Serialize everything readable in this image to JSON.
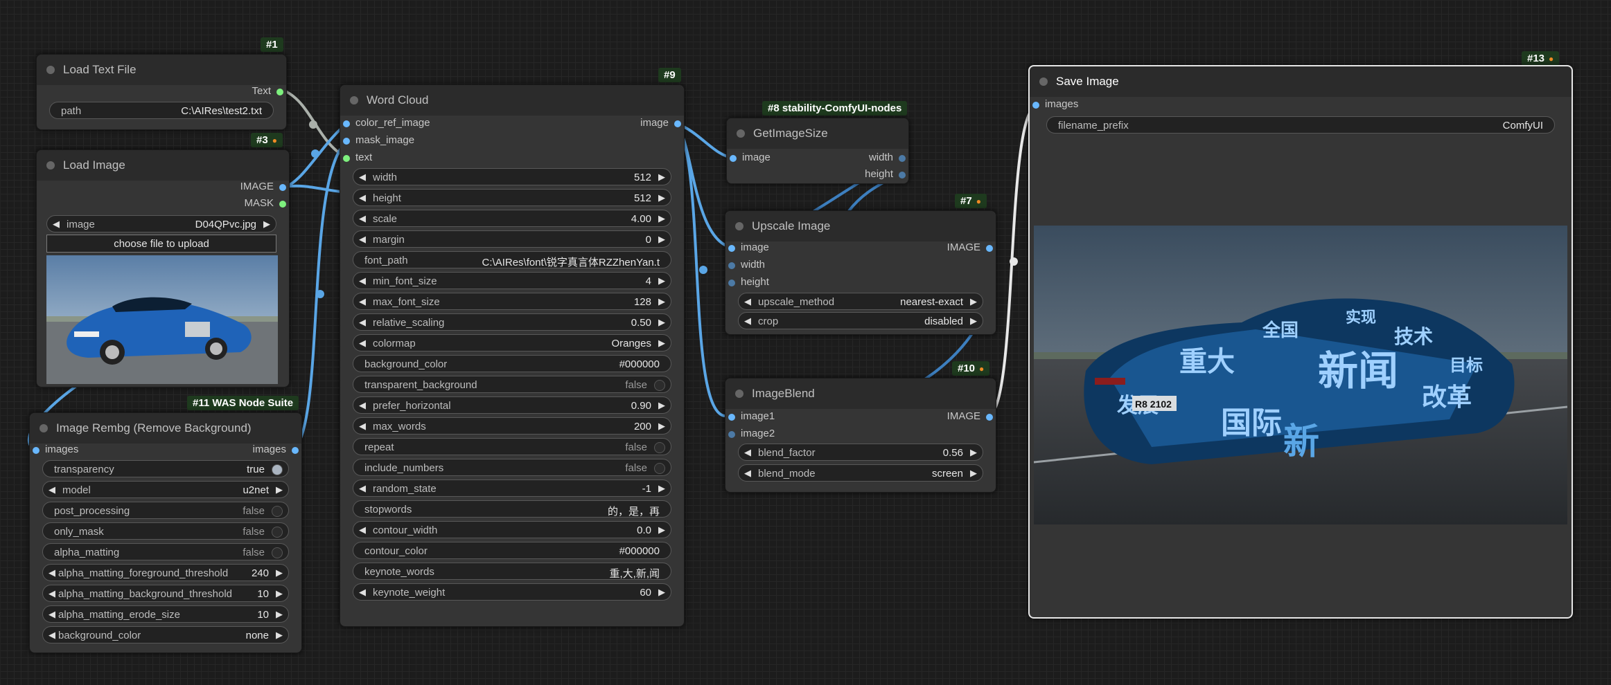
{
  "nodes": {
    "load_text": {
      "badge": "#1",
      "title": "Load Text File",
      "out_text": "Text",
      "path_label": "path",
      "path_value": "C:\\AIRes\\test2.txt"
    },
    "load_image": {
      "badge": "#3",
      "title": "Load Image",
      "out_image": "IMAGE",
      "out_mask": "MASK",
      "image_label": "image",
      "image_value": "D04QPvc.jpg",
      "upload_label": "choose file to upload"
    },
    "rembg": {
      "badge": "#11 WAS Node Suite",
      "title": "Image Rembg (Remove Background)",
      "in_images": "images",
      "out_images": "images",
      "widgets": [
        {
          "label": "transparency",
          "value": "true",
          "kind": "toggle",
          "on": true
        },
        {
          "label": "model",
          "value": "u2net",
          "kind": "combo"
        },
        {
          "label": "post_processing",
          "value": "false",
          "kind": "toggle",
          "on": false
        },
        {
          "label": "only_mask",
          "value": "false",
          "kind": "toggle",
          "on": false
        },
        {
          "label": "alpha_matting",
          "value": "false",
          "kind": "toggle",
          "on": false
        },
        {
          "label": "alpha_matting_foreground_threshold",
          "value": "240",
          "kind": "number"
        },
        {
          "label": "alpha_matting_background_threshold",
          "value": "10",
          "kind": "number"
        },
        {
          "label": "alpha_matting_erode_size",
          "value": "10",
          "kind": "number"
        },
        {
          "label": "background_color",
          "value": "none",
          "kind": "combo"
        }
      ]
    },
    "word_cloud": {
      "badge": "#9",
      "title": "Word Cloud",
      "in_color_ref": "color_ref_image",
      "in_mask": "mask_image",
      "in_text": "text",
      "out_image": "image",
      "widgets": [
        {
          "label": "width",
          "value": "512",
          "kind": "number"
        },
        {
          "label": "height",
          "value": "512",
          "kind": "number"
        },
        {
          "label": "scale",
          "value": "4.00",
          "kind": "number"
        },
        {
          "label": "margin",
          "value": "0",
          "kind": "number"
        },
        {
          "label": "font_path",
          "value": "C:\\AIRes\\font\\锐字真言体RZZhenYan.t",
          "kind": "text"
        },
        {
          "label": "min_font_size",
          "value": "4",
          "kind": "number"
        },
        {
          "label": "max_font_size",
          "value": "128",
          "kind": "number"
        },
        {
          "label": "relative_scaling",
          "value": "0.50",
          "kind": "number"
        },
        {
          "label": "colormap",
          "value": "Oranges",
          "kind": "combo"
        },
        {
          "label": "background_color",
          "value": "#000000",
          "kind": "text"
        },
        {
          "label": "transparent_background",
          "value": "false",
          "kind": "toggle",
          "on": false
        },
        {
          "label": "prefer_horizontal",
          "value": "0.90",
          "kind": "number"
        },
        {
          "label": "max_words",
          "value": "200",
          "kind": "number"
        },
        {
          "label": "repeat",
          "value": "false",
          "kind": "toggle",
          "on": false
        },
        {
          "label": "include_numbers",
          "value": "false",
          "kind": "toggle",
          "on": false
        },
        {
          "label": "random_state",
          "value": "-1",
          "kind": "number"
        },
        {
          "label": "stopwords",
          "value": "的，是，再",
          "kind": "text"
        },
        {
          "label": "contour_width",
          "value": "0.0",
          "kind": "number"
        },
        {
          "label": "contour_color",
          "value": "#000000",
          "kind": "text"
        },
        {
          "label": "keynote_words",
          "value": "重,大,新,闻",
          "kind": "text"
        },
        {
          "label": "keynote_weight",
          "value": "60",
          "kind": "number"
        }
      ]
    },
    "get_size": {
      "badge": "#8 stability-ComfyUI-nodes",
      "title": "GetImageSize",
      "in_image": "image",
      "out_width": "width",
      "out_height": "height"
    },
    "upscale": {
      "badge": "#7",
      "title": "Upscale Image",
      "in_image": "image",
      "in_width": "width",
      "in_height": "height",
      "out_image": "IMAGE",
      "widgets": [
        {
          "label": "upscale_method",
          "value": "nearest-exact",
          "kind": "combo"
        },
        {
          "label": "crop",
          "value": "disabled",
          "kind": "combo"
        }
      ]
    },
    "blend": {
      "badge": "#10",
      "title": "ImageBlend",
      "in_image1": "image1",
      "in_image2": "image2",
      "out_image": "IMAGE",
      "widgets": [
        {
          "label": "blend_factor",
          "value": "0.56",
          "kind": "number"
        },
        {
          "label": "blend_mode",
          "value": "screen",
          "kind": "combo"
        }
      ]
    },
    "save": {
      "badge": "#13",
      "title": "Save Image",
      "in_images": "images",
      "prefix_label": "filename_prefix",
      "prefix_value": "ComfyUI"
    }
  },
  "preview_words": [
    "全国",
    "重大",
    "新闻",
    "技术",
    "国际",
    "改革",
    "实现",
    "发展",
    "目标",
    "新"
  ],
  "plate_text": "R8 2102",
  "colors": {
    "link_blue": "#5aa6e6",
    "link_gray": "#aab0aa",
    "link_white": "#e8e8e8",
    "slot_blue": "#69b8ff",
    "slot_green": "#7ef07e"
  }
}
